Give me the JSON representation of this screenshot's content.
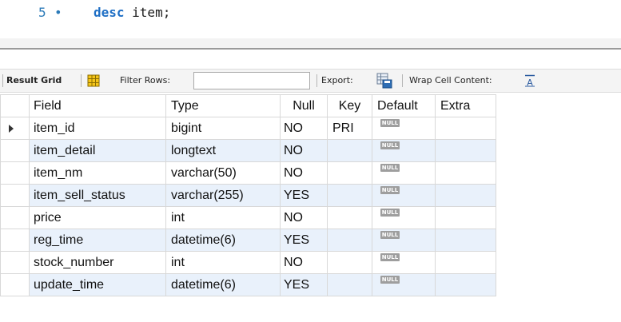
{
  "editor": {
    "line_number": "5",
    "line_marker": "•",
    "keyword": "desc",
    "rest": " item;"
  },
  "toolbar": {
    "result_grid": "Result Grid",
    "filter_rows": "Filter Rows:",
    "filter_value": "",
    "export": "Export:",
    "wrap": "Wrap Cell Content:"
  },
  "table": {
    "columns": [
      "Field",
      "Type",
      "Null",
      "Key",
      "Default",
      "Extra"
    ],
    "null_badge": "NULL",
    "rows": [
      {
        "field": "item_id",
        "type": "bigint",
        "null": "NO",
        "key": "PRI",
        "extra": ""
      },
      {
        "field": "item_detail",
        "type": "longtext",
        "null": "NO",
        "key": "",
        "extra": ""
      },
      {
        "field": "item_nm",
        "type": "varchar(50)",
        "null": "NO",
        "key": "",
        "extra": ""
      },
      {
        "field": "item_sell_status",
        "type": "varchar(255)",
        "null": "YES",
        "key": "",
        "extra": ""
      },
      {
        "field": "price",
        "type": "int",
        "null": "NO",
        "key": "",
        "extra": ""
      },
      {
        "field": "reg_time",
        "type": "datetime(6)",
        "null": "YES",
        "key": "",
        "extra": ""
      },
      {
        "field": "stock_number",
        "type": "int",
        "null": "NO",
        "key": "",
        "extra": ""
      },
      {
        "field": "update_time",
        "type": "datetime(6)",
        "null": "YES",
        "key": "",
        "extra": ""
      }
    ]
  },
  "colors": {
    "alt_row": "#e9f1fb",
    "keyword": "#1f6fc5",
    "line_number": "#2b7ab8"
  }
}
